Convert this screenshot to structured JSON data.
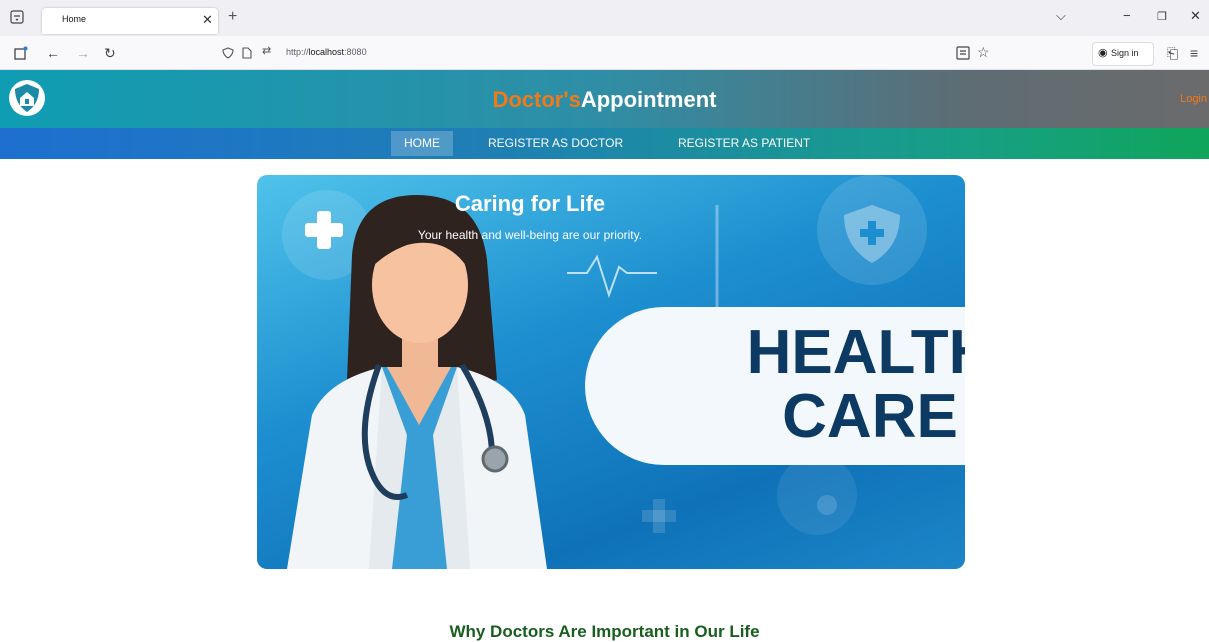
{
  "browser": {
    "tab_title": "Home",
    "url_prefix": "http://",
    "url_host": "localhost",
    "url_port": ":8080",
    "signin_label": "Sign in"
  },
  "site": {
    "brand_part1": "Doctor's",
    "brand_part2": "Appointment",
    "login_label": "Login",
    "nav": {
      "home": "HOME",
      "register_doctor": "REGISTER AS DOCTOR",
      "register_patient": "REGISTER AS PATIENT"
    }
  },
  "banner": {
    "title": "Caring for Life",
    "subtitle": "Your health and well-being are our priority.",
    "headline_line1": "HEALTH",
    "headline_line2": "CARE"
  },
  "section": {
    "heading": "Why Doctors Are Important in Our Life"
  },
  "colors": {
    "brand_orange": "#f07a1a",
    "banner_blue": "#1d8fd0",
    "headline_navy": "#0d3a63",
    "section_green": "#1a5e1f"
  }
}
